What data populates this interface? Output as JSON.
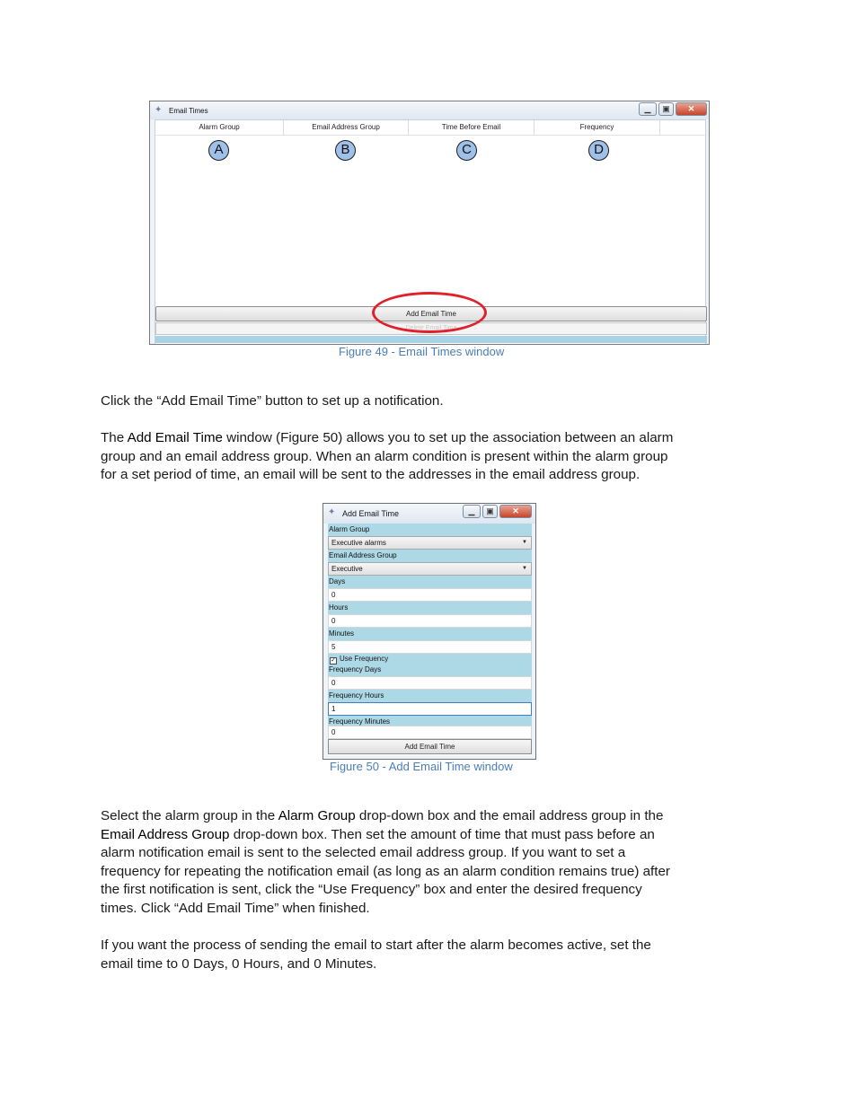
{
  "figure49": {
    "window_title": "Email Times",
    "columns": [
      "Alarm Group",
      "Email Address Group",
      "Time Before Email",
      "Frequency"
    ],
    "callouts": [
      "A",
      "B",
      "C",
      "D"
    ],
    "add_button": "Add Email Time",
    "second_button": "Delete Email Time",
    "caption": "Figure 49 - Email Times window"
  },
  "para1": "Click the “Add Email Time” button to set up a notification.",
  "para2": {
    "pre": "The ",
    "em": "Add Email Time",
    "l1": " window (Figure 50) allows you to set up the association between an alarm",
    "l2": "group and an email address group. When an alarm condition is present within the alarm group",
    "l3": "for a set period of time, an email will be sent to the addresses in the email address group."
  },
  "figure50": {
    "window_title": "Add Email Time",
    "alarm_group_label": "Alarm Group",
    "alarm_group_value": "Executive alarms",
    "email_group_label": "Email Address Group",
    "email_group_value": "Executive",
    "days_label": "Days",
    "days_value": "0",
    "hours_label": "Hours",
    "hours_value": "0",
    "minutes_label": "Minutes",
    "minutes_value": "5",
    "use_frequency_label": "Use Frequency",
    "use_frequency_checked": true,
    "freq_days_label": "Frequency Days",
    "freq_days_value": "0",
    "freq_hours_label": "Frequency Hours",
    "freq_hours_value": "1",
    "freq_minutes_label": "Frequency Minutes",
    "freq_minutes_value": "0",
    "button": "Add Email Time",
    "caption": "Figure 50 - Add Email Time window"
  },
  "para3": {
    "a": "Select the alarm group in the ",
    "b": "Alarm Group",
    "c": " drop-down box and the email address group in the",
    "d": "Email Address Group",
    "e": " drop-down box. Then set the amount of time that must pass before an",
    "l3": "alarm notification email is sent to the selected email address group. If you want to set a",
    "l4": "frequency for repeating the notification email (as long as an alarm condition remains true) after",
    "l5": "the first notification is sent, click the “Use Frequency” box and enter the desired frequency",
    "l6": "times. Click “Add Email Time” when finished."
  },
  "para4": {
    "l1": "If you want the process of sending the email to start after the alarm becomes active, set the",
    "l2": "email time to 0 Days, 0 Hours, and 0 Minutes."
  }
}
